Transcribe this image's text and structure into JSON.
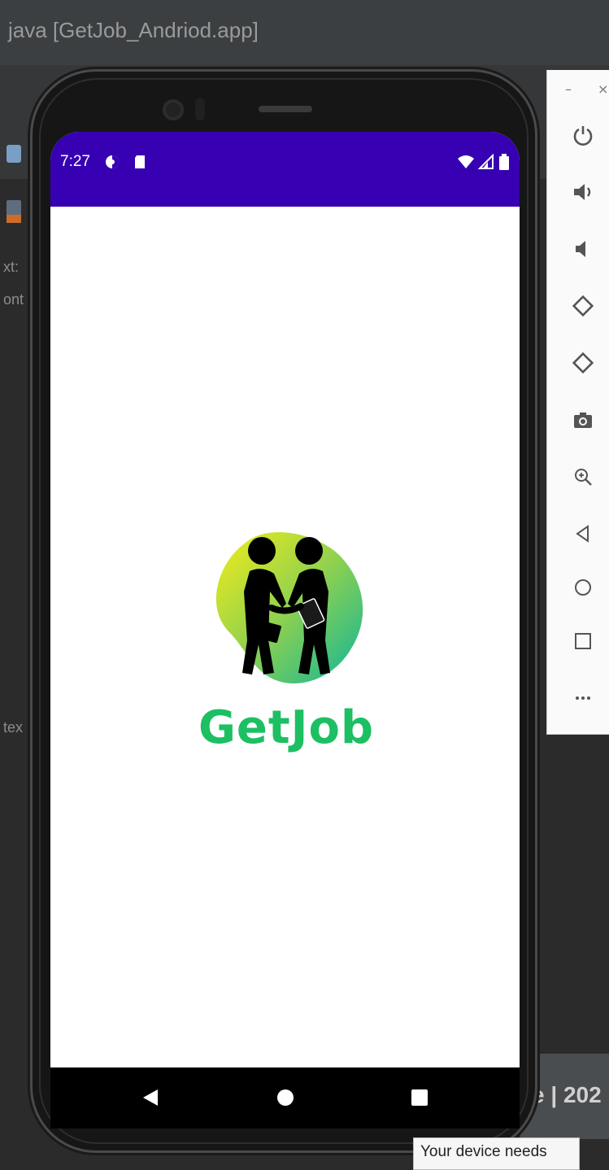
{
  "ide": {
    "window_title": "java [GetJob_Andriod.app]",
    "left_snippets": [
      "xt:",
      "ont",
      "tex"
    ],
    "bottom_partial_text": "e | 202",
    "tooltip_text": "Your device needs"
  },
  "emulator_panel": {
    "window_controls": [
      {
        "name": "minimize",
        "glyph": "–"
      },
      {
        "name": "close",
        "glyph": "×"
      }
    ],
    "buttons": [
      {
        "name": "power",
        "icon": "power-icon"
      },
      {
        "name": "volume-up",
        "icon": "volume-up-icon"
      },
      {
        "name": "volume-down",
        "icon": "volume-down-icon"
      },
      {
        "name": "rotate-left",
        "icon": "rotate-left-icon"
      },
      {
        "name": "rotate-right",
        "icon": "rotate-right-icon"
      },
      {
        "name": "screenshot",
        "icon": "camera-icon"
      },
      {
        "name": "zoom",
        "icon": "zoom-in-icon"
      },
      {
        "name": "back",
        "icon": "back-triangle-icon"
      },
      {
        "name": "home",
        "icon": "home-circle-icon"
      },
      {
        "name": "overview",
        "icon": "overview-square-icon"
      },
      {
        "name": "more",
        "icon": "more-dots-icon"
      }
    ]
  },
  "device": {
    "status_bar": {
      "time": "7:27",
      "color": "#3700b3"
    },
    "app": {
      "brand_name": "GetJob",
      "brand_color": "#1dbf63",
      "logo_icon": "handshake-logo-icon"
    },
    "nav_bar": {
      "buttons": [
        "back-icon",
        "home-icon",
        "recents-icon"
      ]
    }
  }
}
